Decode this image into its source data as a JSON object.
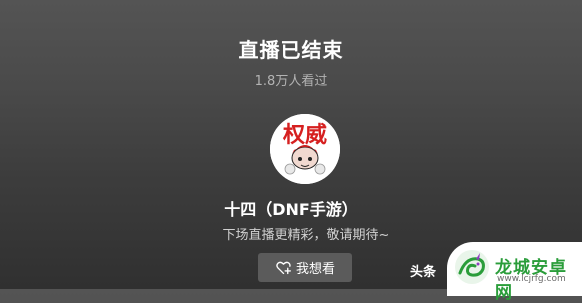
{
  "live": {
    "title": "直播已结束",
    "viewers": "1.8万人看过",
    "streamer_name": "十四（DNF手游）",
    "subtitle": "下场直播更精彩，敬请期待~",
    "want_button_label": "我想看"
  },
  "avatar": {
    "badge_text": "权威",
    "badge_color": "#d62020"
  },
  "watermark": {
    "source": "头条",
    "brand": "龙城安卓网",
    "url": "www.lcjrfg.com",
    "brand_color": "#2a9d3a"
  },
  "icons": {
    "want_button_icon": "heart-plus-icon",
    "watermark_logo": "dragon-logo-icon"
  }
}
